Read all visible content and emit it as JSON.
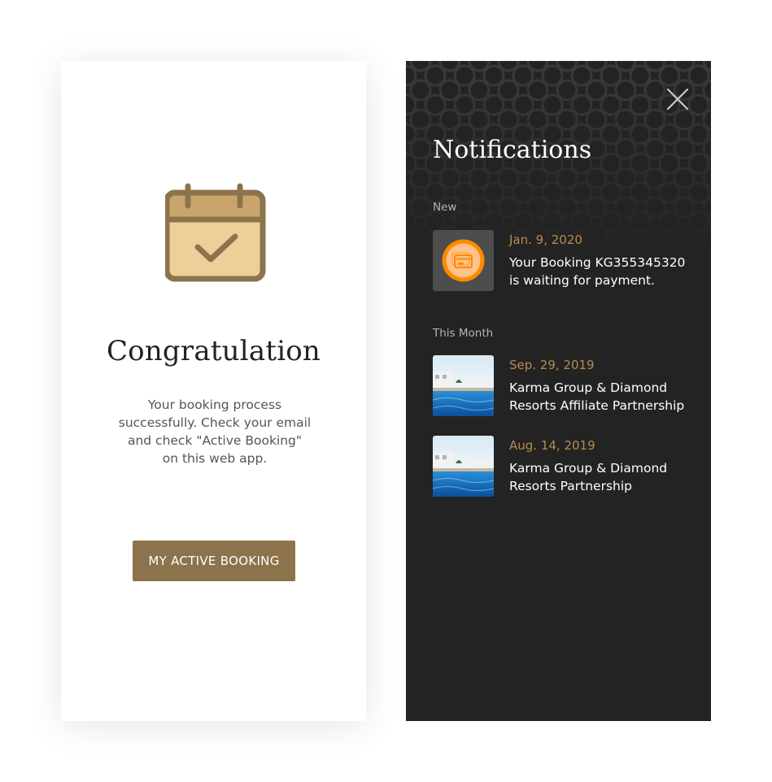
{
  "confirmation": {
    "title": "Congratulation",
    "message": "Your booking process successfully. Check your email and check \"Active Booking\" on this web app.",
    "button_label": "MY ACTIVE BOOKING",
    "icon": "calendar-check-icon",
    "colors": {
      "icon_fill": "#edcf9a",
      "icon_stroke": "#8d734b",
      "button_bg": "#8d734b"
    }
  },
  "notifications": {
    "title": "Notifications",
    "close_icon": "close-icon",
    "sections": [
      {
        "label": "New",
        "items": [
          {
            "date": "Jan. 9, 2020",
            "text": "Your Booking KG355345320 is waiting for payment.",
            "thumb": "payment-card-icon"
          }
        ]
      },
      {
        "label": "This Month",
        "items": [
          {
            "date": "Sep. 29, 2019",
            "text": "Karma Group & Diamond Resorts Affiliate Partnership",
            "thumb": "resort-pool-image"
          },
          {
            "date": "Aug. 14, 2019",
            "text": "Karma Group & Diamond Resorts Partnership",
            "thumb": "resort-pool-image"
          }
        ]
      }
    ],
    "colors": {
      "panel_bg": "#232323",
      "date_accent": "#b88a52",
      "payment_badge": "#ff8a00"
    }
  }
}
